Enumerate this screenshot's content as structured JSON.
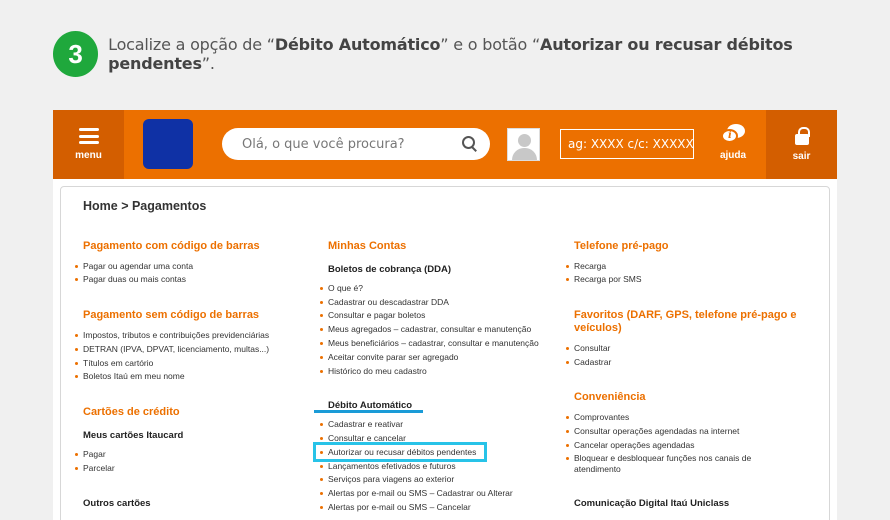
{
  "step": {
    "number": "3",
    "text_pre": "Localize a opção de “",
    "bold1": "Débito Automático",
    "text_mid": "” e o botão “",
    "bold2": "Autorizar ou recusar débitos pendentes",
    "text_post": "”."
  },
  "topbar": {
    "menu_label": "menu",
    "search_placeholder": "Olá, o que você procura?",
    "account_placeholder": "ag: XXXX c/c: XXXXX-X",
    "help_label": "ajuda",
    "logout_label": "sair",
    "colors": {
      "bar": "#ec7000",
      "dark": "#d35e00",
      "logo": "#0f31a5"
    }
  },
  "breadcrumb": "Home > Pagamentos",
  "col1": {
    "s1_title": "Pagamento com código de barras",
    "s1_items": [
      "Pagar ou agendar uma conta",
      "Pagar duas ou mais contas"
    ],
    "s2_title": "Pagamento sem código de barras",
    "s2_items": [
      "Impostos, tributos e contribuições previdenciárias",
      "DETRAN (IPVA, DPVAT, licenciamento, multas...)",
      "Títulos em cartório",
      "Boletos Itaú em meu nome"
    ],
    "s3_title": "Cartões de crédito",
    "s3_sub": "Meus cartões Itaucard",
    "s3_items": [
      "Pagar",
      "Parcelar"
    ],
    "s4_sub": "Outros cartões"
  },
  "col2": {
    "title": "Minhas Contas",
    "sub1": "Boletos de cobrança (DDA)",
    "sub1_items": [
      "O que é?",
      "Cadastrar ou descadastrar DDA",
      "Consultar e pagar boletos",
      "Meus agregados – cadastrar, consultar e manutenção",
      "Meus beneficiários – cadastrar, consultar e manutenção",
      "Aceitar convite parar ser agregado",
      "Histórico do meu cadastro"
    ],
    "sub2": "Débito Automático",
    "sub2_items": [
      "Cadastrar e reativar",
      "Consultar e cancelar",
      "Autorizar ou recusar débitos pendentes",
      "Lançamentos efetivados e futuros",
      "Serviços para viagens ao exterior",
      "Alertas por e-mail ou SMS – Cadastrar ou Alterar",
      "Alertas por e-mail ou SMS – Cancelar"
    ]
  },
  "col3": {
    "s1_title": "Telefone pré-pago",
    "s1_items": [
      "Recarga",
      "Recarga por SMS"
    ],
    "s2_title": "Favoritos (DARF, GPS, telefone pré-pago e veículos)",
    "s2_items": [
      "Consultar",
      "Cadastrar"
    ],
    "s3_title": "Conveniência",
    "s3_items": [
      "Comprovantes",
      "Consultar operações agendadas na internet",
      "Cancelar operações agendadas",
      "Bloquear e desbloquear funções nos canais de atendimento"
    ],
    "s4_sub": "Comunicação Digital Itaú Uniclass"
  }
}
